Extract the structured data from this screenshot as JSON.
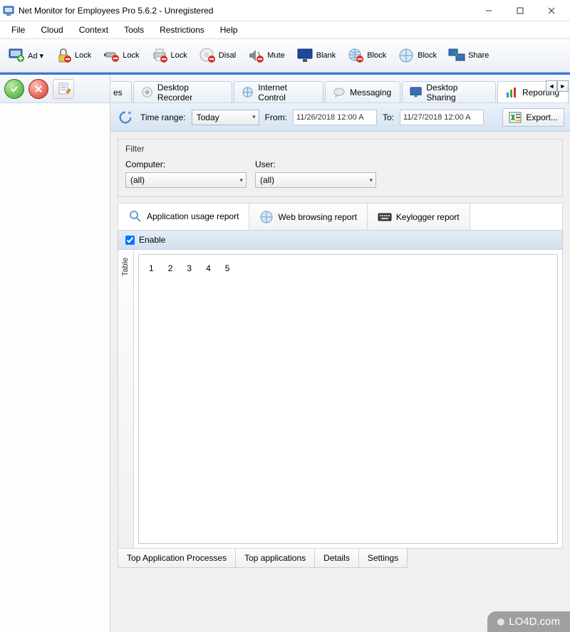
{
  "window": {
    "title": "Net Monitor for Employees Pro 5.6.2 - Unregistered"
  },
  "menu": [
    "File",
    "Cloud",
    "Context",
    "Tools",
    "Restrictions",
    "Help"
  ],
  "toolbar": [
    {
      "label": "Ad",
      "dd": true,
      "icon": "monitor-add"
    },
    {
      "label": "Lock",
      "icon": "lock"
    },
    {
      "label": "Lock",
      "icon": "usb-lock"
    },
    {
      "label": "Lock",
      "icon": "printer-lock"
    },
    {
      "label": "Disal",
      "icon": "cd-disable"
    },
    {
      "label": "Mute",
      "icon": "mute"
    },
    {
      "label": "Blank",
      "icon": "monitor-blank"
    },
    {
      "label": "Block",
      "icon": "globe-block"
    },
    {
      "label": "Block",
      "icon": "globe"
    },
    {
      "label": "Share",
      "icon": "share"
    }
  ],
  "main_tabs": {
    "partial": "es",
    "items": [
      {
        "label": "Desktop Recorder",
        "icon": "recorder"
      },
      {
        "label": "Internet Control",
        "icon": "globe"
      },
      {
        "label": "Messaging",
        "icon": "chat"
      },
      {
        "label": "Desktop Sharing",
        "icon": "monitor"
      },
      {
        "label": "Reporting",
        "icon": "chart",
        "active": true
      }
    ]
  },
  "timebar": {
    "label": "Time range:",
    "range": "Today",
    "from_lbl": "From:",
    "from": "11/26/2018 12:00 A",
    "to_lbl": "To:",
    "to": "11/27/2018 12:00 A",
    "export": "Export..."
  },
  "filter": {
    "title": "Filter",
    "computer_lbl": "Computer:",
    "computer_val": "(all)",
    "user_lbl": "User:",
    "user_val": "(all)"
  },
  "sub_tabs": [
    {
      "label": "Application usage report",
      "icon": "search",
      "active": true
    },
    {
      "label": "Web browsing report",
      "icon": "globe"
    },
    {
      "label": "Keylogger report",
      "icon": "keyboard"
    }
  ],
  "enable_label": "Enable",
  "table": {
    "side": "Table",
    "cols": [
      "1",
      "2",
      "3",
      "4",
      "5"
    ]
  },
  "bottom_tabs": [
    "Top Application Processes",
    "Top applications",
    "Details",
    "Settings"
  ],
  "watermark": "LO4D.com"
}
